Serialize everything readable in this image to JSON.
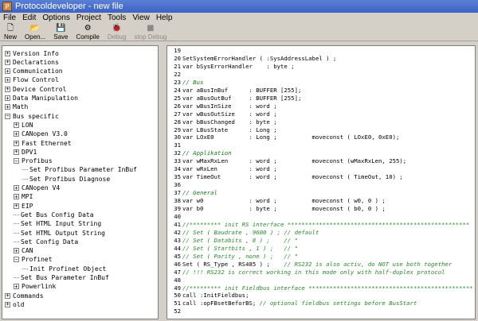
{
  "window": {
    "title": "Protocoldeveloper - new file"
  },
  "menu": [
    "File",
    "Edit",
    "Options",
    "Project",
    "Tools",
    "View",
    "Help"
  ],
  "toolbar": [
    {
      "label": "New",
      "icon": "new-file-icon",
      "glyph": "🗋",
      "enabled": true
    },
    {
      "label": "Open...",
      "icon": "open-folder-icon",
      "glyph": "📂",
      "enabled": true
    },
    {
      "label": "Save",
      "icon": "save-icon",
      "glyph": "💾",
      "enabled": true
    },
    {
      "label": "Compile",
      "icon": "compile-icon",
      "glyph": "⚙",
      "enabled": true
    },
    {
      "label": "Debug",
      "icon": "debug-icon",
      "glyph": "🐞",
      "enabled": false
    },
    {
      "label": "stop Debug",
      "icon": "stop-debug-icon",
      "glyph": "■",
      "enabled": false
    }
  ],
  "tree": [
    {
      "label": "Version Info",
      "depth": 0,
      "box": "+"
    },
    {
      "label": "Declarations",
      "depth": 0,
      "box": "+"
    },
    {
      "label": "Communication",
      "depth": 0,
      "box": "+"
    },
    {
      "label": "Flow Control",
      "depth": 0,
      "box": "+"
    },
    {
      "label": "Device Control",
      "depth": 0,
      "box": "+"
    },
    {
      "label": "Data Manipulation",
      "depth": 0,
      "box": "+"
    },
    {
      "label": "Math",
      "depth": 0,
      "box": "+"
    },
    {
      "label": "Bus specific",
      "depth": 0,
      "box": "-"
    },
    {
      "label": "LON",
      "depth": 1,
      "box": "+"
    },
    {
      "label": "CANopen V3.0",
      "depth": 1,
      "box": "+"
    },
    {
      "label": "Fast Ethernet",
      "depth": 1,
      "box": "+"
    },
    {
      "label": "DPV1",
      "depth": 1,
      "box": "+"
    },
    {
      "label": "Profibus",
      "depth": 1,
      "box": "-"
    },
    {
      "label": "Set Profibus Parameter InBuf",
      "depth": 2,
      "box": ""
    },
    {
      "label": "Set Profibus Diagnose",
      "depth": 2,
      "box": ""
    },
    {
      "label": "CANopen V4",
      "depth": 1,
      "box": "+"
    },
    {
      "label": "MPI",
      "depth": 1,
      "box": "+"
    },
    {
      "label": "EIP",
      "depth": 1,
      "box": "+"
    },
    {
      "label": "Get Bus Config Data",
      "depth": 1,
      "box": ""
    },
    {
      "label": "Set HTML Input String",
      "depth": 1,
      "box": ""
    },
    {
      "label": "Set HTML Output String",
      "depth": 1,
      "box": ""
    },
    {
      "label": "Set Config Data",
      "depth": 1,
      "box": ""
    },
    {
      "label": "CAN",
      "depth": 1,
      "box": "+"
    },
    {
      "label": "Profinet",
      "depth": 1,
      "box": "-"
    },
    {
      "label": "Init Profinet Object",
      "depth": 2,
      "box": ""
    },
    {
      "label": "Set Bus Parameter InBuf",
      "depth": 1,
      "box": ""
    },
    {
      "label": "Powerlink",
      "depth": 1,
      "box": "+"
    },
    {
      "label": "Commands",
      "depth": 0,
      "box": "+"
    },
    {
      "label": "old",
      "depth": 0,
      "box": "+"
    }
  ],
  "code": [
    {
      "n": "19",
      "text": "",
      "kind": "plain"
    },
    {
      "n": "20",
      "text": "SetSystemErrorHandler ( :SysAddressLabel ) ;",
      "kind": "plain"
    },
    {
      "n": "21",
      "text": "var bSysErrorHandler    : byte ;",
      "kind": "plain"
    },
    {
      "n": "22",
      "text": "",
      "kind": "plain"
    },
    {
      "n": "23",
      "text": "// Bus",
      "kind": "section"
    },
    {
      "n": "24",
      "text": "var aBusInBuf      : BUFFER [255];",
      "kind": "plain"
    },
    {
      "n": "25",
      "text": "var aBusOutBuf     : BUFFER [255];",
      "kind": "plain"
    },
    {
      "n": "26",
      "text": "var wBusInSize     : word ;",
      "kind": "plain"
    },
    {
      "n": "27",
      "text": "var wBusOutSize    : word ;",
      "kind": "plain"
    },
    {
      "n": "28",
      "text": "var bBusChanged    : byte ;",
      "kind": "plain"
    },
    {
      "n": "29",
      "text": "var LBusState      : Long ;",
      "kind": "plain"
    },
    {
      "n": "30",
      "text": "var LOxE0          : Long ;          moveconst ( LOxE0, 0xE0);",
      "kind": "plain"
    },
    {
      "n": "31",
      "text": "",
      "kind": "plain"
    },
    {
      "n": "32",
      "text": "// Applikation",
      "kind": "section"
    },
    {
      "n": "33",
      "text": "var wMaxRxLen      : word ;          moveconst (wMaxRxLen, 255);",
      "kind": "plain"
    },
    {
      "n": "34",
      "text": "var wRxLen         : word ;",
      "kind": "plain"
    },
    {
      "n": "35",
      "text": "var TimeOut        : word ;          moveconst ( TimeOut, 10) ;",
      "kind": "plain"
    },
    {
      "n": "36",
      "text": "",
      "kind": "plain"
    },
    {
      "n": "37",
      "text": "// General",
      "kind": "section"
    },
    {
      "n": "38",
      "text": "var w0             : word ;          moveconst ( w0, 0 ) ;",
      "kind": "plain"
    },
    {
      "n": "39",
      "text": "var b0             : byte ;          moveconst ( b0, 0 ) ;",
      "kind": "plain"
    },
    {
      "n": "40",
      "text": "",
      "kind": "plain"
    },
    {
      "n": "41",
      "text": "//********* init RS interface ****************************************************",
      "kind": "comment"
    },
    {
      "n": "42",
      "text": "// Set ( Baudrate , 9600 ) ; // default",
      "kind": "comment"
    },
    {
      "n": "43",
      "text": "// Set ( Databits , 8 ) ;    // \"",
      "kind": "comment"
    },
    {
      "n": "44",
      "text": "// Set ( Startbits , 1 ) ;   // \"",
      "kind": "comment"
    },
    {
      "n": "45",
      "text": "// Set ( Parity , none ) ;   // \"",
      "kind": "comment"
    },
    {
      "n": "46",
      "text": "Set ( RS_Type , RS485 ) ;    // RS232 is also activ, do NOT use both together",
      "kind": "mixed",
      "code": "Set ( RS_Type , RS485 ) ;    ",
      "comment": "// RS232 is also activ, do NOT use both together"
    },
    {
      "n": "47",
      "text": "// !!! RS232 is correct working in this mode only with half-duplex protocol",
      "kind": "comment"
    },
    {
      "n": "48",
      "text": "",
      "kind": "plain"
    },
    {
      "n": "49",
      "text": "//********* init Fieldbus interface ***********************************************",
      "kind": "comment"
    },
    {
      "n": "50",
      "text": "call :InitFieldbus;",
      "kind": "plain"
    },
    {
      "n": "51",
      "text": "call :opFBsetBeforBS; // optional fieldbus settings before BusStart",
      "kind": "mixed",
      "code": "call :opFBsetBeforBS; ",
      "comment": "// optional fieldbus settings before BusStart"
    },
    {
      "n": "52",
      "text": "",
      "kind": "plain"
    }
  ]
}
